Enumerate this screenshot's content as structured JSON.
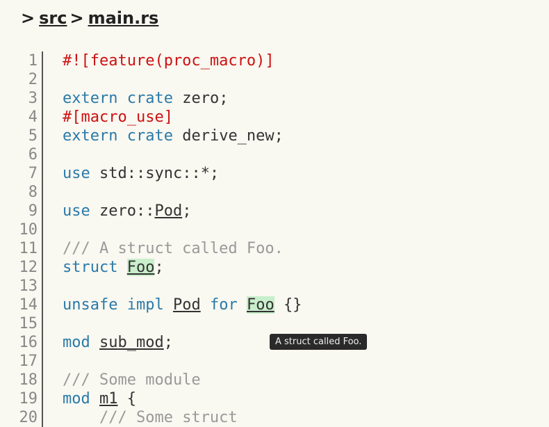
{
  "breadcrumb": {
    "sep": ">",
    "src": "src",
    "file": "main.rs"
  },
  "gutter": {
    "start": 1,
    "end": 20
  },
  "tooltip": "A struct called Foo.",
  "code": {
    "l1": {
      "attr": "#![feature(proc_macro)]"
    },
    "l3": {
      "kw1": "extern",
      "kw2": "crate",
      "name": " zero;"
    },
    "l4": {
      "attr": "#[macro_use]"
    },
    "l5": {
      "kw1": "extern",
      "kw2": "crate",
      "name": " derive_new;"
    },
    "l7": {
      "kw": "use",
      "rest": " std::sync::*;"
    },
    "l9": {
      "kw": "use",
      "seg": " zero::",
      "link": "Pod",
      "tail": ";"
    },
    "l11": {
      "comment": "/// A struct called Foo."
    },
    "l12": {
      "kw": "struct",
      "sp": " ",
      "hl": "Foo",
      "tail": ";"
    },
    "l14": {
      "kw1": "unsafe",
      "kw2": "impl",
      "sp1": " ",
      "link1": "Pod",
      "sp2": " ",
      "kw3": "for",
      "sp3": " ",
      "hl": "Foo",
      "tail": " {}"
    },
    "l16": {
      "kw": "mod",
      "sp": " ",
      "link": "sub_mod",
      "tail": ";"
    },
    "l18": {
      "comment": "/// Some module"
    },
    "l19": {
      "kw": "mod",
      "sp": " ",
      "link": "m1",
      "tail": " {"
    },
    "l20": {
      "indent": "    ",
      "comment": "/// Some struct"
    }
  }
}
